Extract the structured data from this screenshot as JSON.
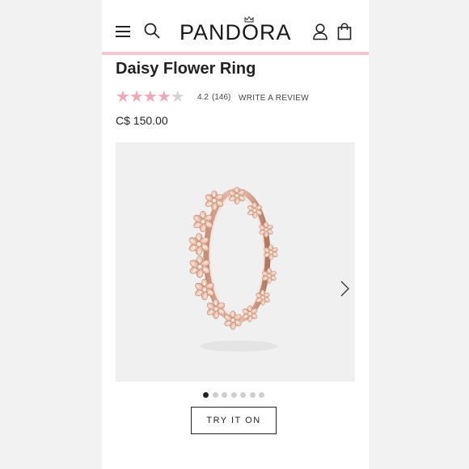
{
  "header": {
    "logo_text": "PANDORA",
    "icons": [
      "menu-icon",
      "search-icon",
      "crown-icon",
      "account-icon",
      "bag-icon"
    ],
    "accent_color": "#f4c7cf"
  },
  "product": {
    "title": "Daisy Flower Ring",
    "rating": "4.2",
    "rating_value": 4.2,
    "rating_max": 5,
    "review_count": "(146)",
    "write_review": "WRITE A REVIEW",
    "price": "C$ 150.00",
    "star_color": "#f0a8b7",
    "star_empty_color": "#d5d5d5"
  },
  "gallery": {
    "image_count": 7,
    "active_index": 0
  },
  "try_on_label": "TRY IT ON"
}
